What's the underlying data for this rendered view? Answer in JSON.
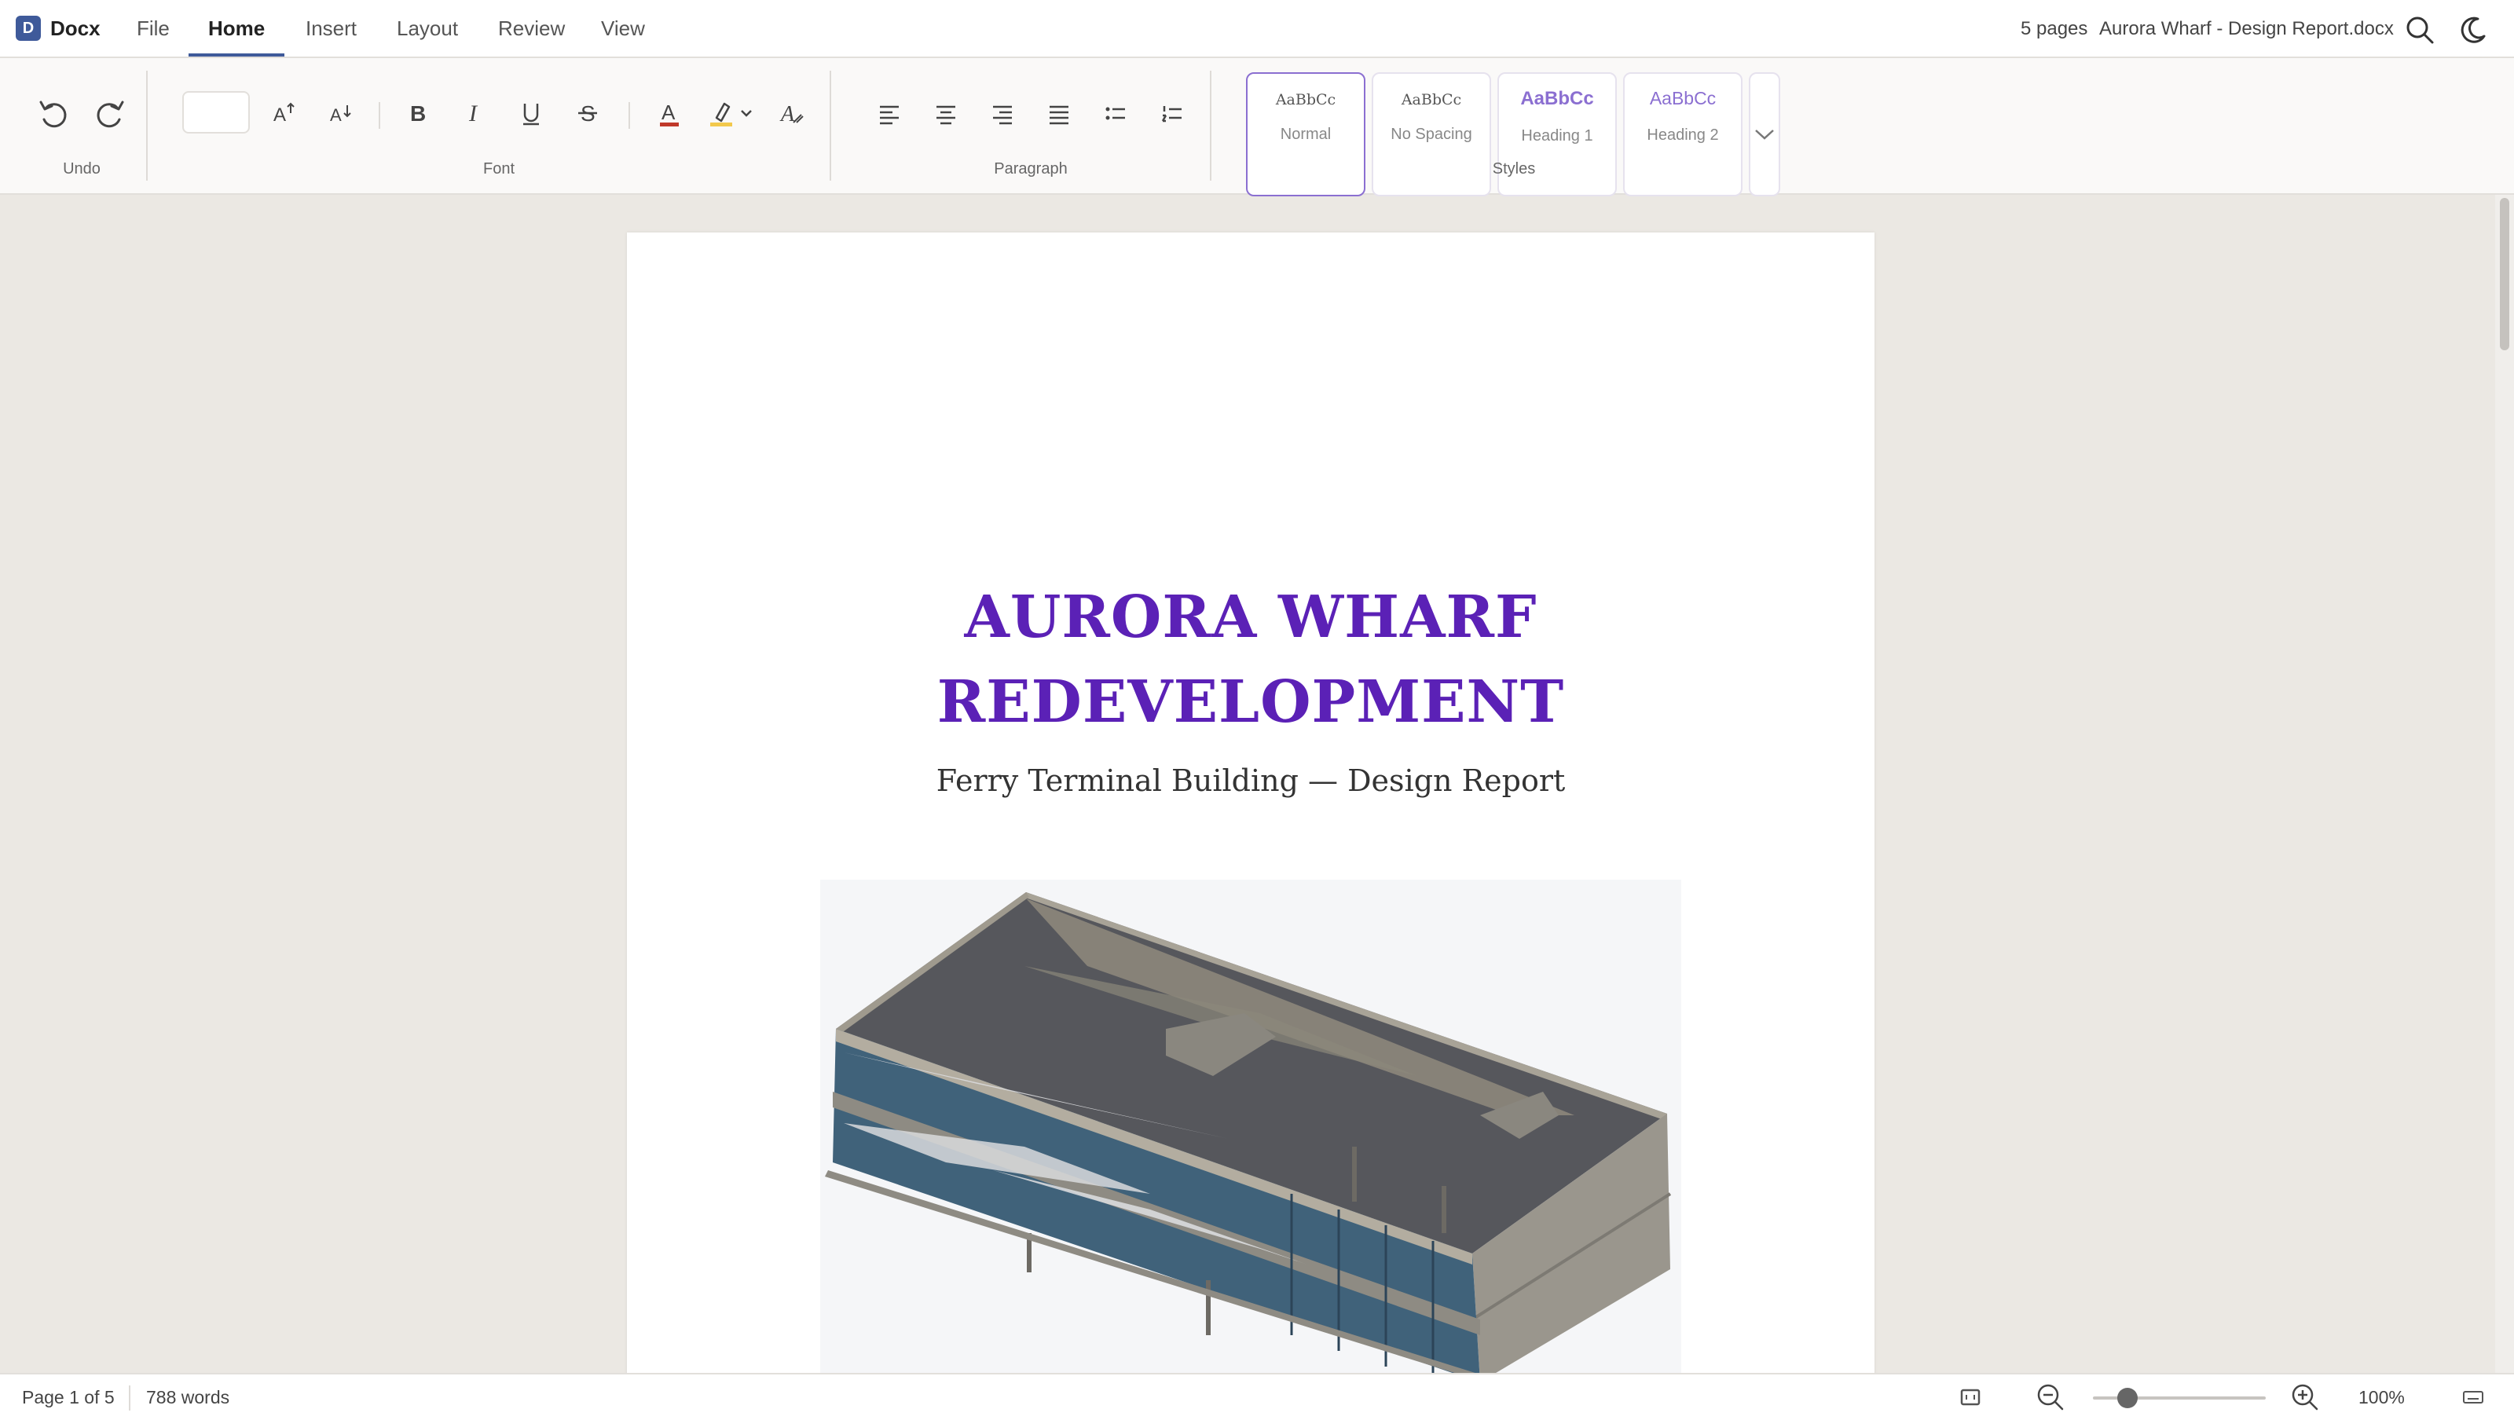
{
  "app": {
    "logo_letter": "D",
    "name": "Docx"
  },
  "menu": {
    "file": "File",
    "home": "Home",
    "insert": "Insert",
    "layout": "Layout",
    "review": "Review",
    "view": "View"
  },
  "header": {
    "pages": "5 pages",
    "filename": "Aurora Wharf - Design Report.docx"
  },
  "ribbon": {
    "groups": {
      "undo": "Undo",
      "font": "Font",
      "paragraph": "Paragraph",
      "styles": "Styles"
    },
    "font_size_value": "",
    "styles": [
      {
        "sample": "AaBbCc",
        "name": "Normal"
      },
      {
        "sample": "AaBbCc",
        "name": "No Spacing"
      },
      {
        "sample": "AaBbCc",
        "name": "Heading 1"
      },
      {
        "sample": "AaBbCc",
        "name": "Heading 2"
      }
    ]
  },
  "document": {
    "title_line1": "AURORA WHARF",
    "title_line2": "REDEVELOPMENT",
    "subtitle": "Ferry Terminal Building — Design Report"
  },
  "status": {
    "page": "Page 1 of 5",
    "words": "788 words",
    "zoom": "100%",
    "zoom_slider_fraction": 0.2
  },
  "colors": {
    "accent": "#3f5a9a",
    "title": "#5b21b6",
    "style_accent": "#8b6fd1"
  }
}
